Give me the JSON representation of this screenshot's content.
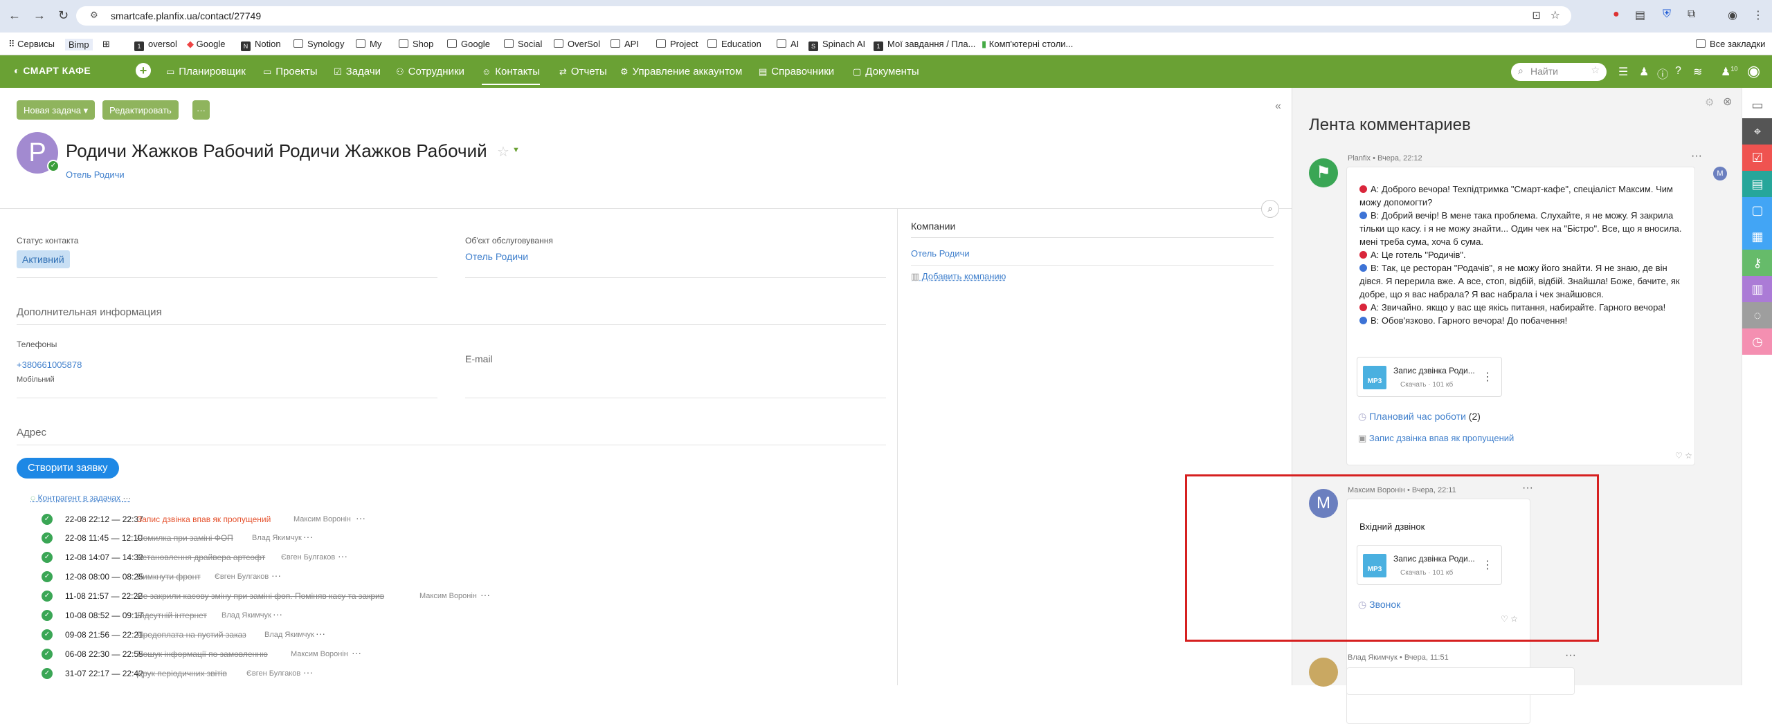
{
  "browser": {
    "url": "smartcafe.planfix.ua/contact/27749"
  },
  "bookmarks": [
    "Сервисы",
    "Bimp",
    "oversol",
    "Google",
    "Notion",
    "Synology",
    "My",
    "Shop",
    "Google",
    "Social",
    "OverSol",
    "API",
    "Project",
    "Education",
    "AI",
    "Spinach AI",
    "Мої завдання / Пла...",
    "Комп'ютерні столи...",
    "Все закладки"
  ],
  "nav": {
    "logo": "СМАРТ КАФЕ",
    "items": [
      "Планировщик",
      "Проекты",
      "Задачи",
      "Сотрудники",
      "Контакты",
      "Отчеты",
      "Управление аккаунтом",
      "Справочники",
      "Документы"
    ],
    "search_placeholder": "Найти",
    "badge": "10"
  },
  "toolbar": {
    "new_task": "Новая задача ▾",
    "edit": "Редактировать",
    "more": "···"
  },
  "contact": {
    "initial": "Р",
    "name": "Родичи Жажков Рабочий Родичи Жажков Рабочий",
    "company": "Отель Родичи"
  },
  "fields": {
    "status_label": "Статус контакта",
    "status_value": "Активний",
    "object_label": "Об'єкт обслуговування",
    "object_value": "Отель Родичи",
    "extra_info": "Дополнительная информация",
    "phones_label": "Телефоны",
    "phone": "+380661005878",
    "phone_type": "Мобільний",
    "email_label": "E-mail",
    "address_label": "Адрес"
  },
  "companies": {
    "title": "Компании",
    "item": "Отель Родичи",
    "add": "Добавить компанию"
  },
  "actions": {
    "create": "Створити заявку",
    "counterparty": "Контрагент в задачах"
  },
  "tasks": [
    {
      "time": "22-08 22:12 — 22:37",
      "name": "Запис дзвінка впав як пропущений",
      "assignee": "Максим Воронін",
      "done": false
    },
    {
      "time": "22-08 11:45 — 12:10",
      "name": "Помилка при заміні ФОП",
      "assignee": "Влад Якимчук",
      "done": true
    },
    {
      "time": "12-08 14:07 — 14:32",
      "name": "Встановлення драйвера артсофт",
      "assignee": "Євген Булгаков",
      "done": true
    },
    {
      "time": "12-08 08:00 — 08:25",
      "name": "Вимкнути фронт",
      "assignee": "Євген Булгаков",
      "done": true
    },
    {
      "time": "11-08 21:57 — 22:22",
      "name": "Не закрили касову зміну при заміні фоп. Поміняв касу та закрив",
      "assignee": "Максим Воронін",
      "done": true
    },
    {
      "time": "10-08 08:52 — 09:17",
      "name": "Відсутній інтернет",
      "assignee": "Влад Якимчук",
      "done": true
    },
    {
      "time": "09-08 21:56 — 22:21",
      "name": "Предоплата на пустий заказ",
      "assignee": "Влад Якимчук",
      "done": true
    },
    {
      "time": "06-08 22:30 — 22:55",
      "name": "Пошук інформації по замовленню",
      "assignee": "Максим Воронін",
      "done": true
    },
    {
      "time": "31-07 22:17 — 22:42",
      "name": "Друк періодичних звітів",
      "assignee": "Євген Булгаков",
      "done": true
    }
  ],
  "feed": {
    "title": "Лента комментариев",
    "c1": {
      "meta": "Planfix • Вчера, 22:12",
      "lines": [
        {
          "who": "A",
          "text": "A: Доброго вечора! Техпідтримка \"Смарт-кафе\", спеціаліст Максим. Чим можу допомогти?"
        },
        {
          "who": "B",
          "text": "B: Добрий вечір! В мене така проблема. Слухайте, я не можу. Я закрила тільки що касу. і я не можу знайти... Один чек на \"Бістро\". Все, що я вносила. мені треба сума, хоча б сума."
        },
        {
          "who": "A",
          "text": "A: Це готель \"Родичів\"."
        },
        {
          "who": "B",
          "text": "B: Так, це ресторан \"Родачів\", я не можу його знайти. Я не знаю, де він дівся. Я перерила вже. А все, стоп, відбій, відбій. Знайшла! Боже, бачите, як добре, що я вас набрала? Я вас набрала і чек знайшовся."
        },
        {
          "who": "A",
          "text": "A: Звичайно. якщо у вас ще якісь питання, набирайте. Гарного вечора!"
        },
        {
          "who": "B",
          "text": "B: Обов'язково. Гарного вечора! До побачення!"
        }
      ],
      "file": "Запис дзвінка Роди...",
      "download": "Скачать · 101 кб",
      "link1": "Плановий час роботи",
      "link1_count": "(2)",
      "link2": "Запис дзвінка впав як пропущений"
    },
    "c2": {
      "meta": "Максим Воронін • Вчера, 22:11",
      "initial": "M",
      "text": "Вхідний дзвінок",
      "file": "Запис дзвінка Роди...",
      "download": "Скачать · 101 кб",
      "link": "Звонок"
    },
    "c3": {
      "meta": "Влад Якимчук • Вчера, 11:51"
    }
  },
  "colors": {
    "green": "#6aa134",
    "blue": "#3f7fcc",
    "red": "#d62020"
  }
}
